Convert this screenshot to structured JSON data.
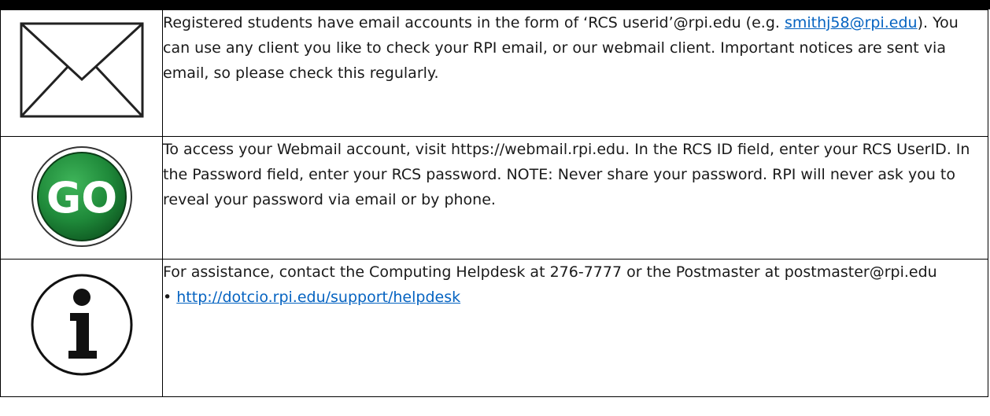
{
  "rows": [
    {
      "icon": "envelope-icon",
      "text_before_link": "Registered students have email accounts in the form of ‘RCS userid’@rpi.edu (e.g. ",
      "link_text": "smithj58@rpi.edu",
      "link_paren": ")",
      "text_after_link": ".  You can use any client you like to check your RPI email, or our webmail client.  Important notices are sent via email, so please check this regularly."
    },
    {
      "icon": "go-icon",
      "icon_label": "GO",
      "text": "To access your Webmail account, visit https://webmail.rpi.edu. In the RCS ID field, enter your RCS UserID. In the Password field, enter your RCS password. NOTE: Never share your password. RPI will never ask you to reveal your password via email or by phone."
    },
    {
      "icon": "info-icon",
      "text": "For assistance, contact the Computing Helpdesk at 276-7777 or the Postmaster at postmaster@rpi.edu",
      "bullet": "• ",
      "link_text": "http://dotcio.rpi.edu/support/helpdesk"
    }
  ],
  "colors": {
    "link": "#0563c1",
    "go_green": "#1f8a3a",
    "border": "#000000"
  }
}
